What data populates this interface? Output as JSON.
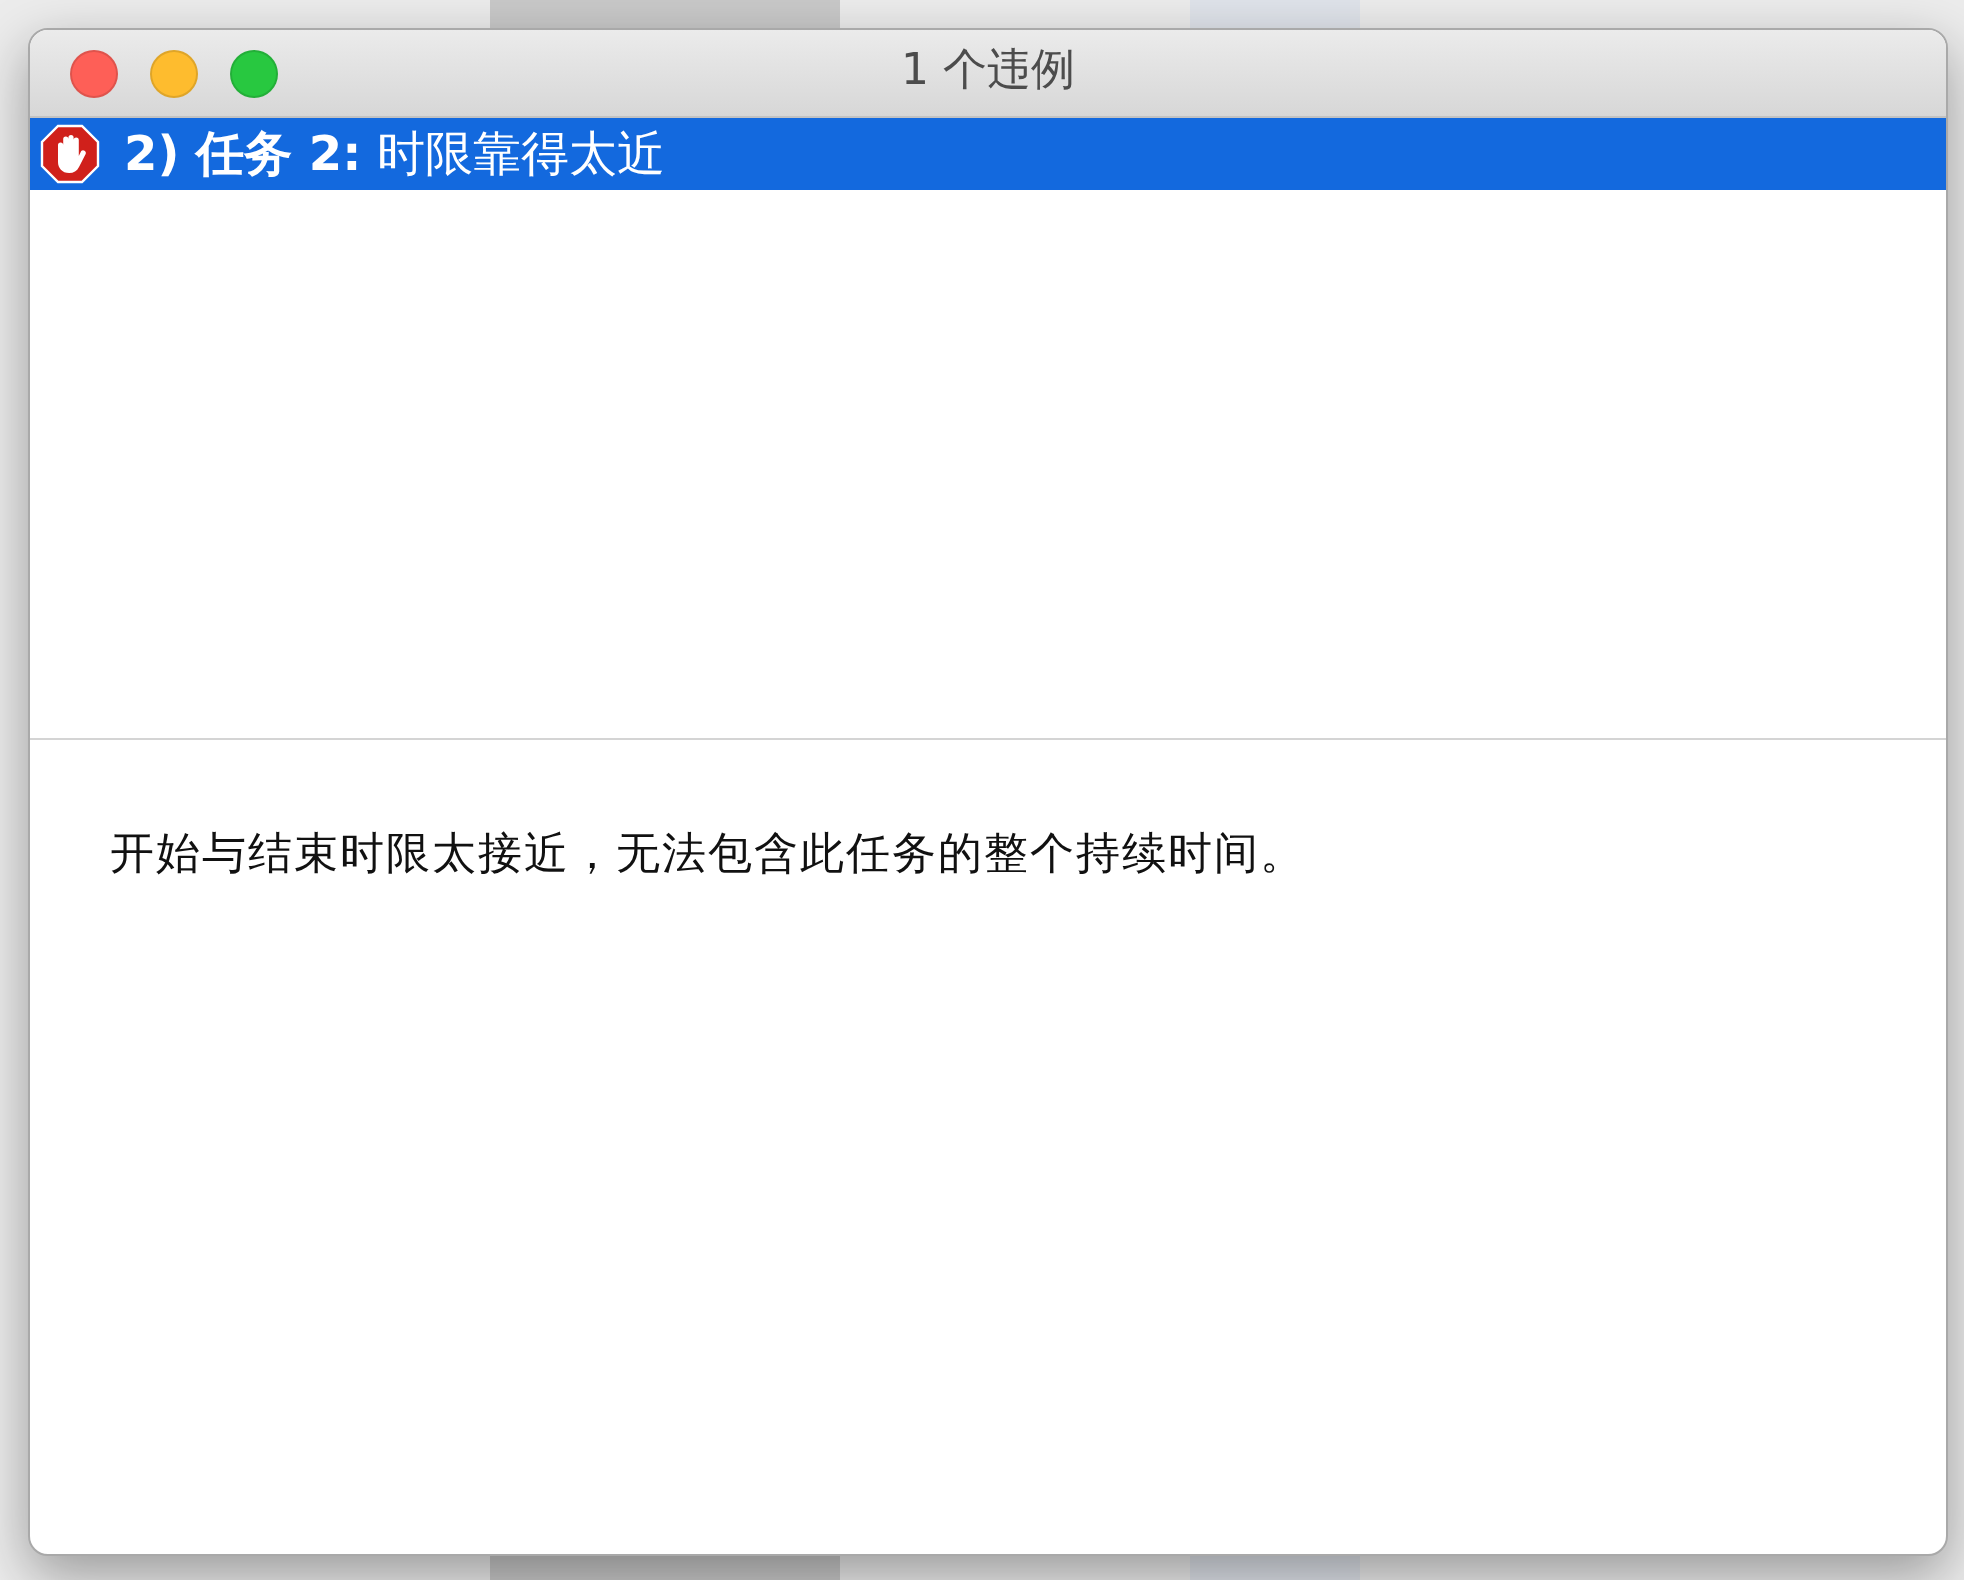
{
  "window": {
    "title": "1 个违例"
  },
  "violations": [
    {
      "kind": "error",
      "text": "**2) 任务 2:** 时限靠得太近",
      "selected": true
    }
  ],
  "description": "开始与结束时限太接近，无法包含此任务的整个持续时间。"
}
